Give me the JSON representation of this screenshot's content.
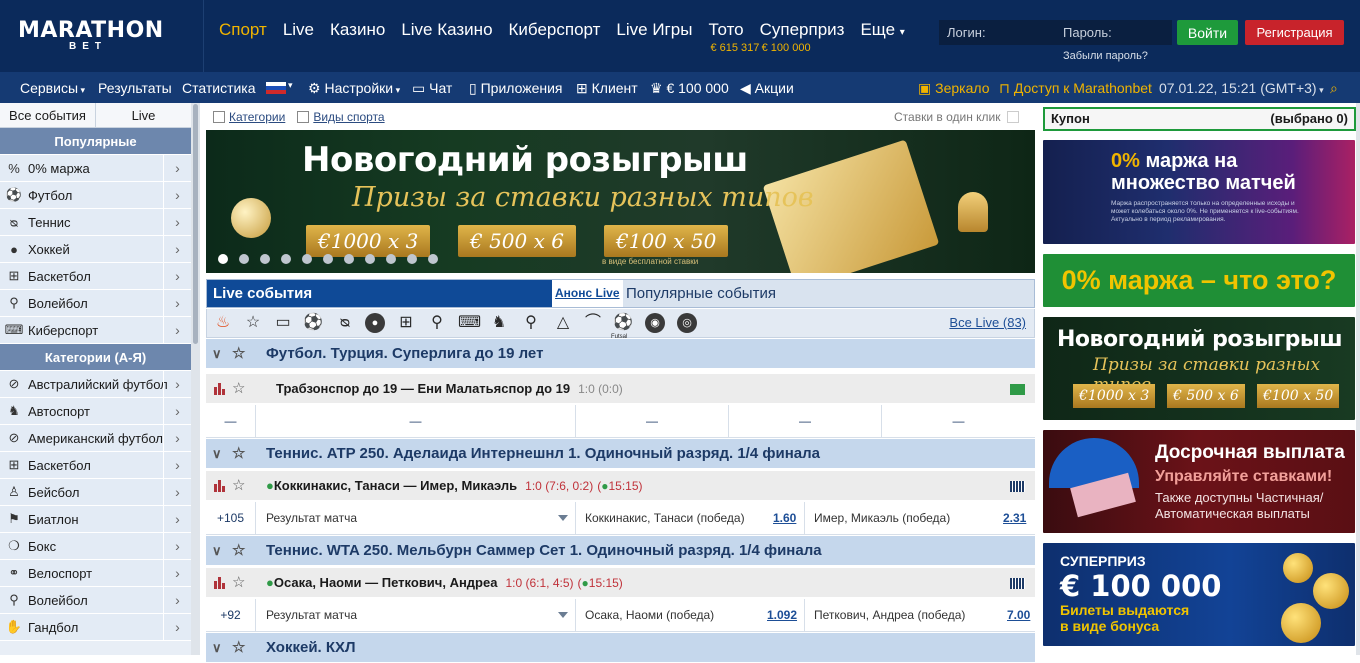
{
  "header": {
    "logo_top": "MARATHON",
    "logo_bottom": "BET",
    "nav": [
      {
        "label": "Спорт",
        "active": true,
        "sub": ""
      },
      {
        "label": "Live",
        "active": false,
        "sub": ""
      },
      {
        "label": "Казино",
        "active": false,
        "sub": ""
      },
      {
        "label": "Live Казино",
        "active": false,
        "sub": ""
      },
      {
        "label": "Киберспорт",
        "active": false,
        "sub": ""
      },
      {
        "label": "Live Игры",
        "active": false,
        "sub": ""
      },
      {
        "label": "Тото",
        "active": false,
        "sub": "€ 615 317"
      },
      {
        "label": "Суперприз",
        "active": false,
        "sub": "€ 100 000"
      },
      {
        "label": "Еще",
        "active": false,
        "sub": ""
      }
    ],
    "login_placeholder": "Логин:",
    "password_placeholder": "Пароль:",
    "login_button": "Войти",
    "register_button": "Регистрация",
    "forgot": "Забыли пароль?",
    "accent": "#f0b400"
  },
  "subnav": {
    "services": "Сервисы",
    "results": "Результаты",
    "stats": "Статистика",
    "settings": "Настройки",
    "chat": "Чат",
    "apps": "Приложения",
    "client": "Клиент",
    "jackpot": "€ 100 000",
    "promos": "Акции",
    "mirror": "Зеркало",
    "access": "Доступ к Marathonbet",
    "datetime": "07.01.22, 15:21 (GMT+3)"
  },
  "sidebar": {
    "tab_all": "Все события",
    "tab_live": "Live",
    "popular_title": "Популярные",
    "popular": [
      {
        "label": "0% маржа",
        "icon": "margin-icon"
      },
      {
        "label": "Футбол",
        "icon": "football-icon"
      },
      {
        "label": "Теннис",
        "icon": "tennis-icon"
      },
      {
        "label": "Хоккей",
        "icon": "hockey-icon"
      },
      {
        "label": "Баскетбол",
        "icon": "basketball-icon"
      },
      {
        "label": "Волейбол",
        "icon": "volleyball-icon"
      },
      {
        "label": "Киберспорт",
        "icon": "esports-icon"
      }
    ],
    "categories_title": "Категории (А-Я)",
    "categories": [
      {
        "label": "Австралийский футбол",
        "icon": "aussie-football-icon"
      },
      {
        "label": "Автоспорт",
        "icon": "motorsport-icon"
      },
      {
        "label": "Американский футбол",
        "icon": "american-football-icon"
      },
      {
        "label": "Баскетбол",
        "icon": "basketball-icon"
      },
      {
        "label": "Бейсбол",
        "icon": "baseball-icon"
      },
      {
        "label": "Биатлон",
        "icon": "biathlon-icon"
      },
      {
        "label": "Бокс",
        "icon": "boxing-icon"
      },
      {
        "label": "Велоспорт",
        "icon": "cycling-icon"
      },
      {
        "label": "Волейбол",
        "icon": "volleyball-icon"
      },
      {
        "label": "Гандбол",
        "icon": "handball-icon"
      }
    ]
  },
  "filters": {
    "categories": "Категории",
    "sports": "Виды спорта",
    "one_click": "Ставки в один клик"
  },
  "banner": {
    "title": "Новогодний розыгрыш",
    "subtitle": "Призы за ставки разных типов",
    "prizes": [
      "€1000 x 3",
      "€ 500 x 6",
      "€100 x 50"
    ],
    "note": "в виде бесплатной ставки"
  },
  "live": {
    "title": "Live события",
    "announce": "Анонс Live",
    "popular": "Популярные события",
    "all_live": "Все Live (83)",
    "sport_icons": [
      "fire-icon",
      "star-icon",
      "tv-icon",
      "football-icon",
      "tennis-icon",
      "hockey-icon",
      "basketball-icon",
      "volleyball-icon",
      "esports-icon",
      "horse-racing-icon",
      "badminton-icon",
      "snooker-icon",
      "table-tennis-icon",
      "futsal-icon",
      "ice-hockey-puck-icon",
      "darts-icon"
    ],
    "futsal_label": "Futsal",
    "leagues": [
      {
        "title": "Футбол. Турция. Суперлига до 19 лет",
        "match": "Трабзонспор до 19 — Ени Малатьяспор до 19",
        "score": "1:0 (0:0)",
        "live_dot": false,
        "time": "",
        "more": "—",
        "market": "",
        "sel1": "—",
        "odd1": "",
        "sel2": "—",
        "odd2": "",
        "dash3": "—",
        "dash4": "—"
      },
      {
        "title": "Теннис. ATP 250. Аделаида Интернешнл 1. Одиночный разряд. 1/4 финала",
        "match": "Коккинакис, Танаси — Имер, Микаэль",
        "score": "1:0 (7:6, 0:2)",
        "live_dot": true,
        "time": "15:15",
        "more": "+105",
        "market": "Результат матча",
        "sel1": "Коккинакис, Танаси (победа)",
        "odd1": "1.60",
        "sel2": "Имер, Микаэль (победа)",
        "odd2": "2.31"
      },
      {
        "title": "Теннис. WTA 250. Мельбурн Саммер Сет 1. Одиночный разряд. 1/4 финала",
        "match": "Осака, Наоми — Петкович, Андреа",
        "score": "1:0 (6:1, 4:5)",
        "live_dot": true,
        "time": "15:15",
        "more": "+92",
        "market": "Результат матча",
        "sel1": "Осака, Наоми (победа)",
        "odd1": "1.092",
        "sel2": "Петкович, Андреа (победа)",
        "odd2": "7.00"
      },
      {
        "title": "Хоккей. КХЛ"
      }
    ]
  },
  "coupon": {
    "title": "Купон",
    "count": "(выбрано 0)"
  },
  "ads": {
    "ad1_big_pct": "0%",
    "ad1_big_rest": "маржа на",
    "ad1_big_line2": "множество матчей",
    "ad1_small": "Маржа распространяется только на определенные исходы и может колебаться около 0%. Не применяется к live-событиям. Актуально в период рекламирования.",
    "ad2_pct": "0%",
    "ad2_text": "маржа – что это?",
    "ad3_title": "Новогодний розыгрыш",
    "ad3_subtitle": "Призы за ставки разных типов",
    "ad3_prizes": [
      "€1000 x 3",
      "€ 500 x 6",
      "€100 x 50"
    ],
    "ad4_title": "Досрочная выплата",
    "ad4_sub": "Управляйте ставками!",
    "ad4_text1": "Также доступны Частичная/",
    "ad4_text2": "Автоматическая выплаты",
    "ad5_label": "СУПЕРПРИЗ",
    "ad5_amount": "€ 100 000",
    "ad5_line1": "Билеты выдаются",
    "ad5_line2a": "в виде ",
    "ad5_line2b": "бонуса"
  }
}
